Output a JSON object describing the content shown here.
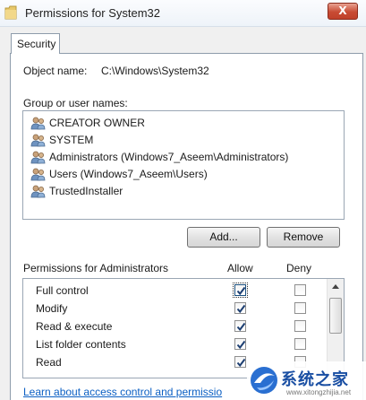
{
  "window": {
    "title": "Permissions for System32",
    "close_label": "X",
    "icon": "folder-icon"
  },
  "tabs": [
    {
      "label": "Security",
      "active": true
    }
  ],
  "object": {
    "label": "Object name:",
    "value": "C:\\Windows\\System32"
  },
  "groups": {
    "label": "Group or user names:",
    "items": [
      {
        "name": "CREATOR OWNER",
        "icon": "users-icon"
      },
      {
        "name": "SYSTEM",
        "icon": "users-icon"
      },
      {
        "name": "Administrators (Windows7_Aseem\\Administrators)",
        "icon": "users-icon"
      },
      {
        "name": "Users (Windows7_Aseem\\Users)",
        "icon": "users-icon"
      },
      {
        "name": "TrustedInstaller",
        "icon": "users-icon"
      }
    ],
    "add_label": "Add...",
    "remove_label": "Remove"
  },
  "permissions": {
    "label": "Permissions for Administrators",
    "allow_header": "Allow",
    "deny_header": "Deny",
    "rows": [
      {
        "name": "Full control",
        "allow": true,
        "deny": false
      },
      {
        "name": "Modify",
        "allow": true,
        "deny": false
      },
      {
        "name": "Read & execute",
        "allow": true,
        "deny": false
      },
      {
        "name": "List folder contents",
        "allow": true,
        "deny": false
      },
      {
        "name": "Read",
        "allow": true,
        "deny": false
      }
    ]
  },
  "link": {
    "label": "Learn about access control and permissio"
  },
  "watermark": {
    "text": "系统之家",
    "url": "www.xitongzhijia.net"
  },
  "colors": {
    "link": "#0b5fc3",
    "close_button": "#c84b33",
    "check": "#1d3f72",
    "border": "#8e9cab"
  }
}
